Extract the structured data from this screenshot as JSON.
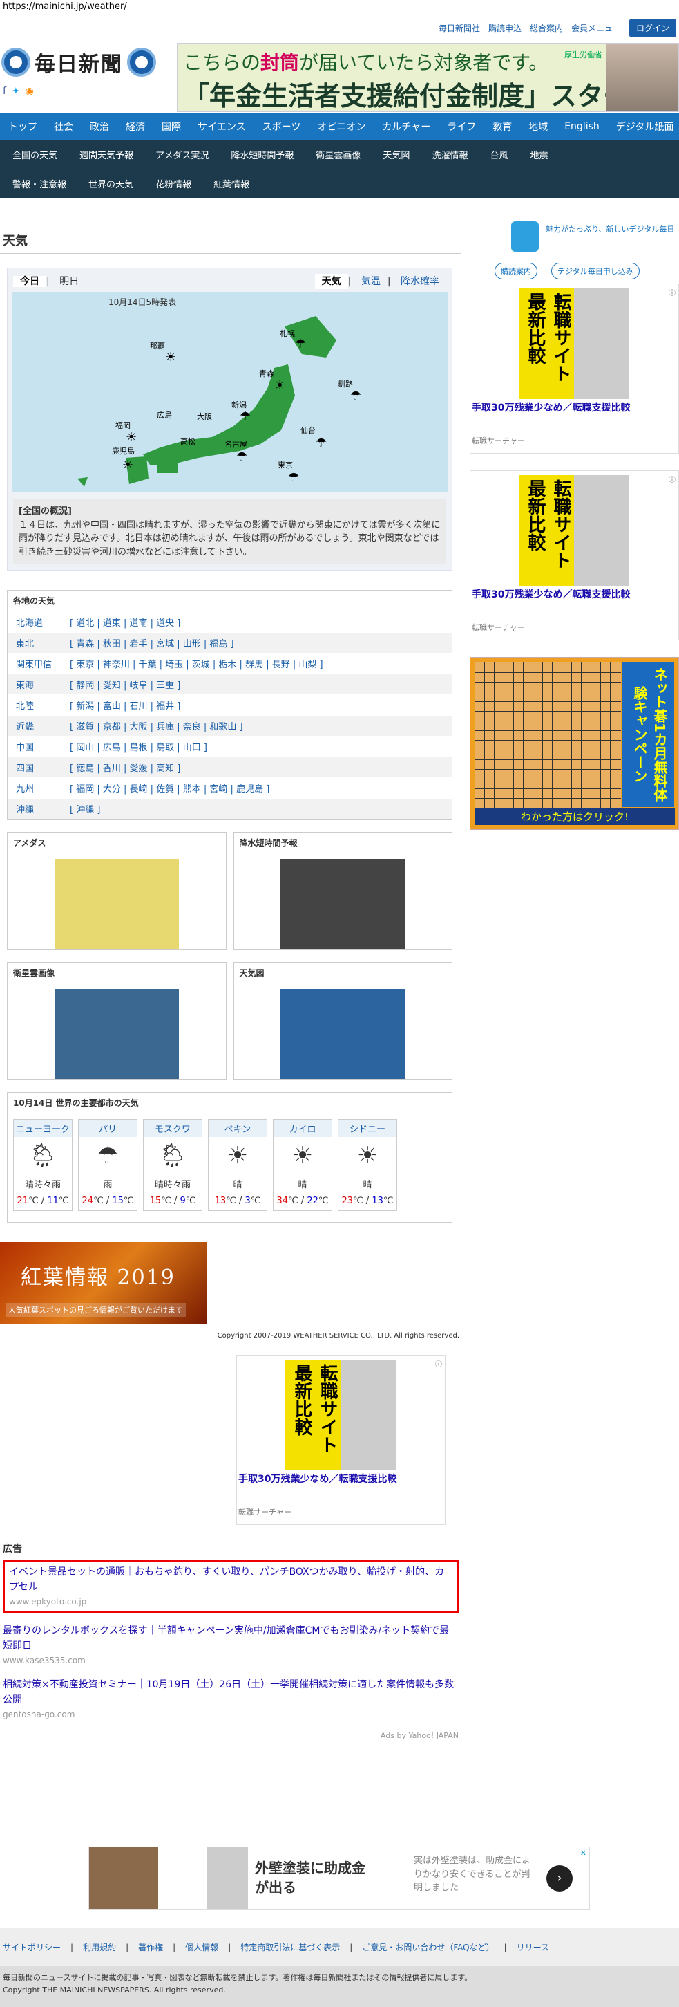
{
  "browser": {
    "url": "https://mainichi.jp/weather/"
  },
  "header": {
    "links": [
      "毎日新聞社",
      "購読申込",
      "総合案内",
      "会員メニュー"
    ],
    "login": "ログイン",
    "logo": "毎日新聞"
  },
  "top_ad": {
    "line1_pre": "こちらの",
    "line1_em": "封筒",
    "line1_post": "が届いていたら対象者です。",
    "line2": "「年金生活者支援給付金制度」スタート",
    "ministry": "厚生労働省"
  },
  "nav_main": [
    "トップ",
    "社会",
    "政治",
    "経済",
    "国際",
    "サイエンス",
    "スポーツ",
    "オピニオン",
    "カルチャー",
    "ライフ",
    "教育",
    "地域",
    "English",
    "デジタル紙面"
  ],
  "nav_weather_row1": [
    "全国の天気",
    "週間天気予報",
    "アメダス実況",
    "降水短時間予報",
    "衛星雲画像",
    "天気図",
    "洗濯情報",
    "台風",
    "地震"
  ],
  "nav_weather_row2": [
    "警報・注意報",
    "世界の天気",
    "花粉情報",
    "紅葉情報"
  ],
  "page_title": "天気",
  "forecast": {
    "day_tabs": [
      "今日",
      "明日"
    ],
    "view_tabs": [
      "天気",
      "気温",
      "降水確率"
    ],
    "issued": "10月14日5時発表",
    "cities": [
      "札幌",
      "那覇",
      "青森",
      "釧路",
      "広島",
      "大阪",
      "新潟",
      "福岡",
      "仙台",
      "高松",
      "名古屋",
      "東京",
      "鹿児島"
    ],
    "summary_title": "[全国の概況]",
    "summary": "１４日は、九州や中国・四国は晴れますが、湿った空気の影響で近畿から関東にかけては雲が多く次第に雨が降りだす見込みです。北日本は初め晴れますが、午後は雨の所があるでしょう。東北や関東などでは引き続き土砂災害や河川の増水などには注意して下さい。"
  },
  "regions": {
    "title": "各地の天気",
    "rows": [
      {
        "name": "北海道",
        "prefs": "[ 道北 | 道東 | 道南 | 道央 ]"
      },
      {
        "name": "東北",
        "prefs": "[ 青森 | 秋田 | 岩手 | 宮城 | 山形 | 福島 ]"
      },
      {
        "name": "関東甲信",
        "prefs": "[ 東京 | 神奈川 | 千葉 | 埼玉 | 茨城 | 栃木 | 群馬 | 長野 | 山梨 ]"
      },
      {
        "name": "東海",
        "prefs": "[ 静岡 | 愛知 | 岐阜 | 三重 ]"
      },
      {
        "name": "北陸",
        "prefs": "[ 新潟 | 富山 | 石川 | 福井 ]"
      },
      {
        "name": "近畿",
        "prefs": "[ 滋賀 | 京都 | 大阪 | 兵庫 | 奈良 | 和歌山 ]"
      },
      {
        "name": "中国",
        "prefs": "[ 岡山 | 広島 | 島根 | 鳥取 | 山口 ]"
      },
      {
        "name": "四国",
        "prefs": "[ 徳島 | 香川 | 愛媛 | 高知 ]"
      },
      {
        "name": "九州",
        "prefs": "[ 福岡 | 大分 | 長崎 | 佐賀 | 熊本 | 宮崎 | 鹿児島 ]"
      },
      {
        "name": "沖縄",
        "prefs": "[ 沖縄 ]"
      }
    ]
  },
  "panels": [
    "アメダス",
    "降水短時間予報",
    "衛星雲画像",
    "天気図"
  ],
  "world": {
    "title": "10月14日 世界の主要都市の天気",
    "cities": [
      {
        "name": "ニューヨーク",
        "weather": "晴時々雨",
        "icon": "sun-rain",
        "hi": "21",
        "lo": "11"
      },
      {
        "name": "パリ",
        "weather": "雨",
        "icon": "umbrella",
        "hi": "24",
        "lo": "15"
      },
      {
        "name": "モスクワ",
        "weather": "晴時々雨",
        "icon": "sun-rain",
        "hi": "15",
        "lo": "9"
      },
      {
        "name": "ペキン",
        "weather": "晴",
        "icon": "sun",
        "hi": "13",
        "lo": "3"
      },
      {
        "name": "カイロ",
        "weather": "晴",
        "icon": "sun",
        "hi": "34",
        "lo": "22"
      },
      {
        "name": "シドニー",
        "weather": "晴",
        "icon": "sun",
        "hi": "23",
        "lo": "13"
      }
    ],
    "unit": "℃",
    "sep": " / "
  },
  "koyo": {
    "title": "紅葉情報 2019",
    "sub": "人気紅葉スポットの見ごろ情報がご覧いただけます"
  },
  "copyright_ws": "Copyright 2007-2019 WEATHER SERVICE CO., LTD. All rights reserved.",
  "ad_generic": {
    "vertical": "転職サイト最新比較",
    "headline": "手取30万残業少なめ／転職支援比較",
    "source": "転職サーチャー"
  },
  "ads": {
    "title": "広告",
    "items": [
      {
        "text": "イベント景品セットの通販｜おもちゃ釣り、すくい取り、パンチBOXつかみ取り、輪投げ・射的、カプセル",
        "url": "www.epkyoto.co.jp"
      },
      {
        "text": "最寄りのレンタルボックスを探す｜半額キャンペーン実施中/加瀬倉庫CMでもお馴染み/ネット契約で最短即日",
        "url": "www.kase3535.com"
      },
      {
        "text": "相続対策×不動産投資セミナー｜10月19日（土）26日（土）一挙開催相続対策に適した案件情報も多数公開",
        "url": "gentosha-go.com"
      }
    ],
    "credit": "Ads by Yahoo! JAPAN"
  },
  "banner": {
    "main": "外壁塗装に助成金が出る",
    "side": "実は外壁塗装は、助成金によりかなり安くできることが判明しました"
  },
  "footer": {
    "links": [
      "サイトポリシー",
      "利用規約",
      "著作権",
      "個人情報",
      "特定商取引法に基づく表示",
      "ご意見・お問い合わせ（FAQなど）",
      "リリース"
    ],
    "notice": "毎日新聞のニュースサイトに掲載の記事・写真・図表など無断転載を禁止します。著作権は毎日新聞社またはその情報提供者に属します。",
    "copyright": "Copyright THE MAINICHI NEWSPAPERS. All rights reserved."
  },
  "sidebar": {
    "promo": "魅力がたっぷり、新しいデジタル毎日",
    "promo_btn1": "購読案内",
    "promo_btn2": "デジタル毎日申し込み",
    "go_ad": {
      "side": "ネット碁1カ月無料体験キャンペーン",
      "bottom": "わかった方はクリック!"
    }
  }
}
